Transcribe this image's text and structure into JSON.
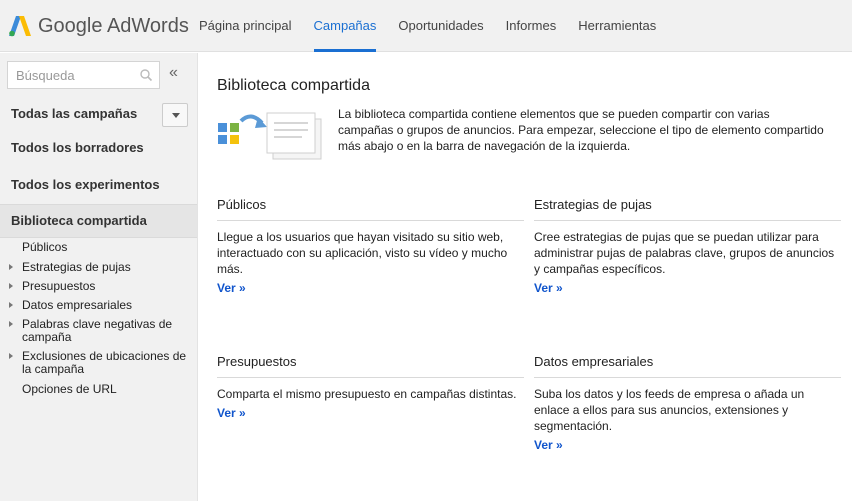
{
  "brand": {
    "name": "Google AdWords"
  },
  "nav": [
    {
      "label": "Página principal",
      "active": false
    },
    {
      "label": "Campañas",
      "active": true
    },
    {
      "label": "Oportunidades",
      "active": false
    },
    {
      "label": "Informes",
      "active": false
    },
    {
      "label": "Herramientas",
      "active": false
    }
  ],
  "sidebar": {
    "search_placeholder": "Búsqueda",
    "collapse_glyph": "«",
    "items": [
      {
        "label": "Todas las campañas"
      },
      {
        "label": "Todos los borradores"
      },
      {
        "label": "Todos los experimentos"
      },
      {
        "label": "Biblioteca compartida"
      }
    ],
    "subitems": [
      {
        "label": "Públicos",
        "expandable": false
      },
      {
        "label": "Estrategias de pujas",
        "expandable": true
      },
      {
        "label": "Presupuestos",
        "expandable": true
      },
      {
        "label": "Datos empresariales",
        "expandable": true
      },
      {
        "label": "Palabras clave negativas de campaña",
        "expandable": true
      },
      {
        "label": "Exclusiones de ubicaciones de la campaña",
        "expandable": true
      },
      {
        "label": "Opciones de URL",
        "expandable": false
      }
    ]
  },
  "main": {
    "title": "Biblioteca compartida",
    "intro": "La biblioteca compartida contiene elementos que se pueden compartir con varias campañas o grupos de anuncios. Para empezar, seleccione el tipo de elemento compartido más abajo o en la barra de navegación de la izquierda.",
    "cards": [
      {
        "title": "Públicos",
        "desc": "Llegue a los usuarios que hayan visitado su sitio web, interactuado con su aplicación, visto su vídeo y mucho más.",
        "link": "Ver »"
      },
      {
        "title": "Estrategias de pujas",
        "desc": "Cree estrategias de pujas que se puedan utilizar para administrar pujas de palabras clave, grupos de anuncios y campañas específicos.",
        "link": "Ver »"
      },
      {
        "title": "Presupuestos",
        "desc": "Comparta el mismo presupuesto en campañas distintas.",
        "link": "Ver »"
      },
      {
        "title": "Datos empresariales",
        "desc": "Suba los datos y los feeds de empresa o añada un enlace a ellos para sus anuncios, extensiones y segmentación.",
        "link": "Ver »"
      }
    ]
  },
  "colors": {
    "accent": "#1a6fd2",
    "link": "#1155cc",
    "sidebar_bg": "#f1f1f1"
  }
}
